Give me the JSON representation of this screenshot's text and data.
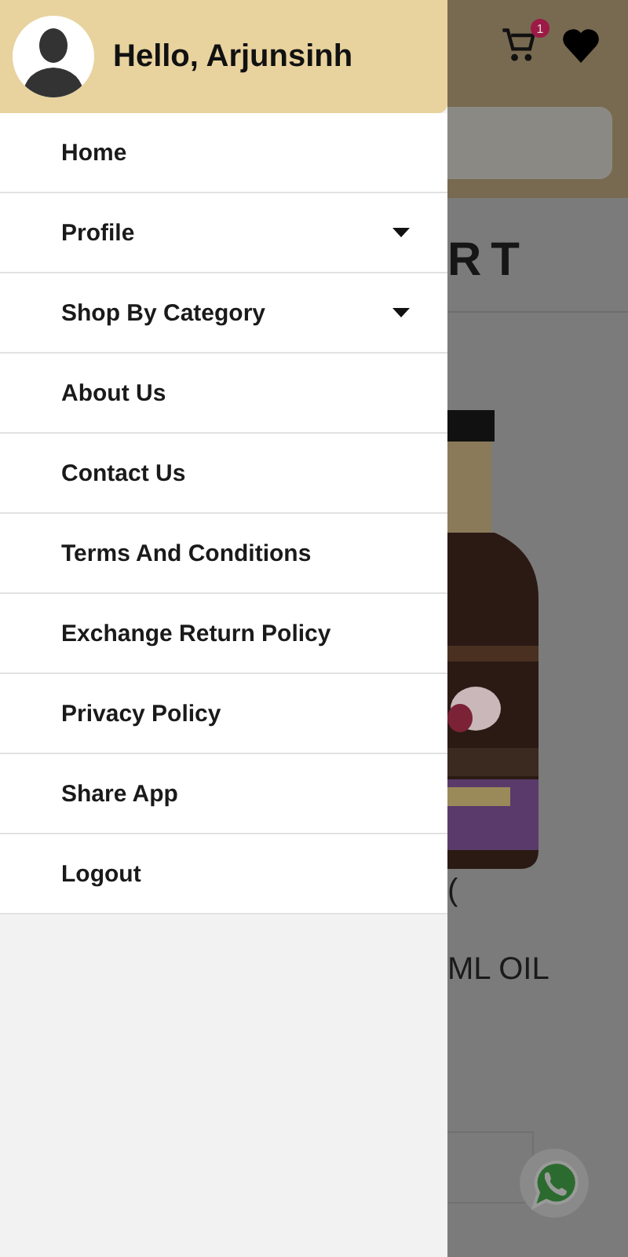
{
  "drawer": {
    "greeting": "Hello, Arjunsinh",
    "items": [
      {
        "label": "Home",
        "expandable": false
      },
      {
        "label": "Profile",
        "expandable": true
      },
      {
        "label": "Shop By Category",
        "expandable": true
      },
      {
        "label": "About Us",
        "expandable": false
      },
      {
        "label": "Contact Us",
        "expandable": false
      },
      {
        "label": "Terms And Conditions",
        "expandable": false
      },
      {
        "label": "Exchange Return Policy",
        "expandable": false
      },
      {
        "label": "Privacy Policy",
        "expandable": false
      },
      {
        "label": "Share App",
        "expandable": false
      },
      {
        "label": "Logout",
        "expandable": false
      }
    ]
  },
  "background": {
    "cart_badge": "1",
    "heading": "RT",
    "product_text_1": "(",
    "product_text_2": "ML OIL"
  }
}
